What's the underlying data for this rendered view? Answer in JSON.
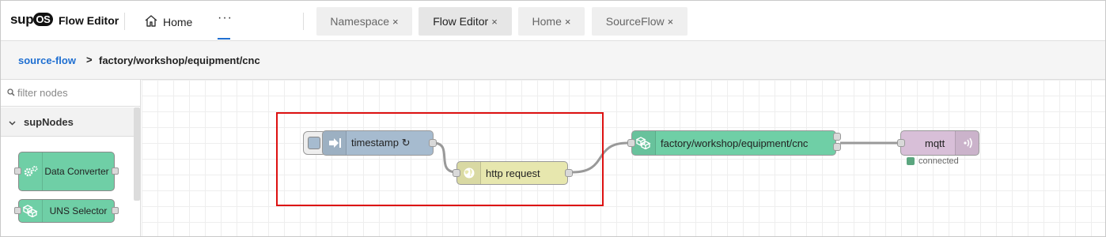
{
  "header": {
    "logo": {
      "prefix": "sup",
      "badge": "OS"
    },
    "app_title": "Flow Editor",
    "home_label": "Home",
    "more_label": "···",
    "tabs": [
      {
        "label": "Namespace",
        "close": "×",
        "active": false
      },
      {
        "label": "Flow Editor",
        "close": "×",
        "active": true
      },
      {
        "label": "Home",
        "close": "×",
        "active": false
      },
      {
        "label": "SourceFlow",
        "close": "×",
        "active": false
      }
    ]
  },
  "breadcrumb": {
    "link": "source-flow",
    "separator": ">",
    "current": "factory/workshop/equipment/cnc"
  },
  "palette": {
    "filter_placeholder": "filter nodes",
    "category": "supNodes",
    "nodes": [
      {
        "label": "Data Converter",
        "icon": "gears-icon"
      },
      {
        "label": "UNS Selector",
        "icon": "cubes-icon"
      }
    ]
  },
  "flow": {
    "nodes": [
      {
        "id": "inject",
        "label": "timestamp ↻",
        "icon": "arrow-in-icon",
        "color": "#a6bbcf"
      },
      {
        "id": "http",
        "label": "http request",
        "icon": "globe-icon",
        "color": "#e7e7ae"
      },
      {
        "id": "uns",
        "label": "factory/workshop/equipment/cnc",
        "icon": "cubes-icon",
        "color": "#6fcfa6"
      },
      {
        "id": "mqtt",
        "label": "mqtt",
        "icon": "broadcast-icon",
        "color": "#d8bfd8"
      }
    ],
    "mqtt_status": "connected",
    "mqtt_status_color": "#5ba67f"
  },
  "colors": {
    "accent": "#1f6fd1",
    "highlight": "#dd1111"
  }
}
